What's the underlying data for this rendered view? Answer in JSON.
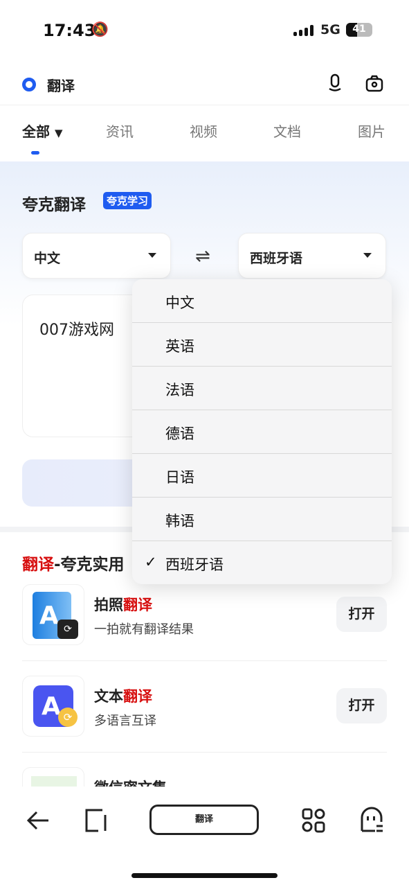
{
  "status_bar": {
    "time": "17:43",
    "network": "5G",
    "battery": "41",
    "battery_level": 0.41
  },
  "search": {
    "query": "翻译",
    "brand_color": "#1f5cf0"
  },
  "tabs": [
    {
      "label": "全部",
      "active": true
    },
    {
      "label": "资讯"
    },
    {
      "label": "视频"
    },
    {
      "label": "文档"
    },
    {
      "label": "图片"
    }
  ],
  "translator": {
    "title": "夸克翻译",
    "badge": "夸克学习",
    "source_lang": "中文",
    "target_lang": "西班牙语",
    "input_text": "007游戏网"
  },
  "dropdown": {
    "options": [
      "中文",
      "英语",
      "法语",
      "德语",
      "日语",
      "韩语",
      "西班牙语"
    ],
    "selected": "西班牙语",
    "check": "✓"
  },
  "section": {
    "title_highlight": "翻译",
    "title_rest": "-夸克实用"
  },
  "tools": [
    {
      "title": "拍照",
      "title_highlight": "翻译",
      "subtitle": "一拍就有翻译结果",
      "button": "打开"
    },
    {
      "title": "文本",
      "title_highlight": "翻译",
      "subtitle": "多语言互译",
      "button": "打开"
    },
    {
      "title": "微信密文集",
      "title_highlight": "",
      "subtitle": "",
      "button": ""
    }
  ],
  "bottom_nav": {
    "address_label": "翻译"
  },
  "colors": {
    "highlight": "#d70f0f",
    "accent": "#1f5cf0"
  }
}
